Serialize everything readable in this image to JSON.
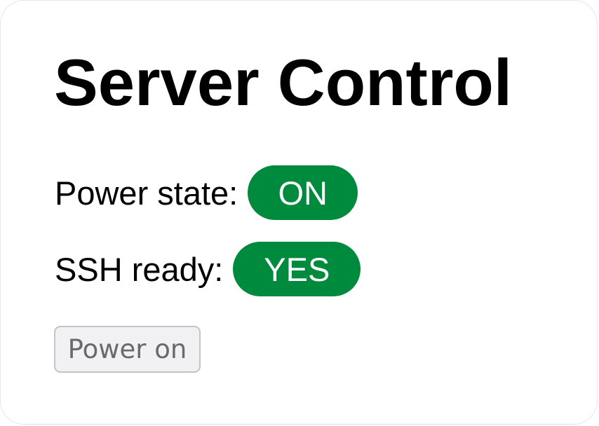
{
  "title": "Server Control",
  "power": {
    "label": "Power state:",
    "value": "ON",
    "color": "#008a3e"
  },
  "ssh": {
    "label": "SSH ready:",
    "value": "YES",
    "color": "#008a3e"
  },
  "power_button": {
    "label": "Power on",
    "disabled": true
  }
}
